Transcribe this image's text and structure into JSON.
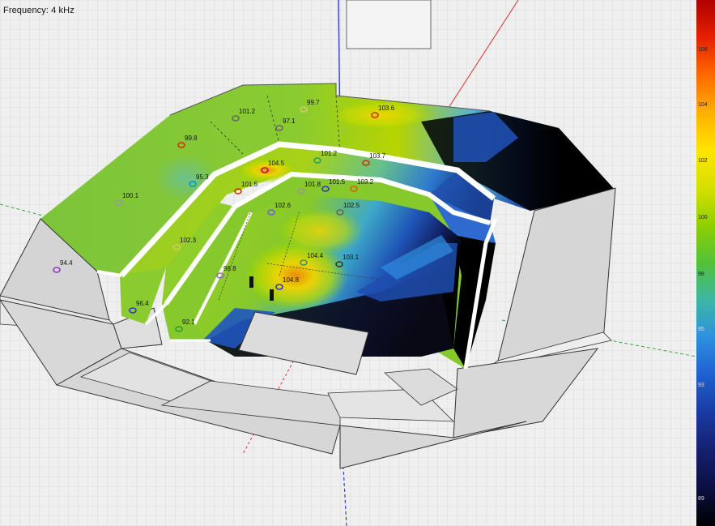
{
  "header": {
    "frequency_label": "Frequency: 4 kHz"
  },
  "legend": {
    "ticks": [
      "106",
      "104",
      "102",
      "100",
      "98",
      "95",
      "93",
      "",
      "",
      "89"
    ],
    "colors": [
      "#b00000",
      "#e62000",
      "#ff6a00",
      "#ffb000",
      "#ffe400",
      "#d6e000",
      "#8fcf00",
      "#52c23a",
      "#3cb6a6",
      "#2f8fe0",
      "#1f5fd0",
      "#1a3aa0",
      "#151f6e",
      "#0b0f40",
      "#000000"
    ]
  },
  "measurements": [
    {
      "label": "101.2",
      "color": "#666666"
    },
    {
      "label": "99.7",
      "color": "#cccc66"
    },
    {
      "label": "97.1",
      "color": "#666666"
    },
    {
      "label": "103.6",
      "color": "#cc3300"
    },
    {
      "label": "99.8",
      "color": "#cc3300"
    },
    {
      "label": "95.3",
      "color": "#0099cc"
    },
    {
      "label": "104.5",
      "color": "#cc0066"
    },
    {
      "label": "101.2",
      "color": "#339966"
    },
    {
      "label": "103.7",
      "color": "#cc3300"
    },
    {
      "label": "101.5",
      "color": "#cc3300"
    },
    {
      "label": "101.5",
      "color": "#3333cc"
    },
    {
      "label": "103.2",
      "color": "#cc6600"
    },
    {
      "label": "101.8",
      "color": "#999999"
    },
    {
      "label": "100.1",
      "color": "#999999"
    },
    {
      "label": "102.6",
      "color": "#6666cc"
    },
    {
      "label": "102.5",
      "color": "#666666"
    },
    {
      "label": "102.3",
      "color": "#cccc66"
    },
    {
      "label": "104.4",
      "color": "#339966"
    },
    {
      "label": "103.1",
      "color": "#333333"
    },
    {
      "label": "98.8",
      "color": "#9966cc"
    },
    {
      "label": "104.8",
      "color": "#3333cc"
    },
    {
      "label": "94.4",
      "color": "#9933cc"
    },
    {
      "label": "96.4",
      "color": "#3333cc"
    },
    {
      "label": "92.1",
      "color": "#339933"
    }
  ]
}
